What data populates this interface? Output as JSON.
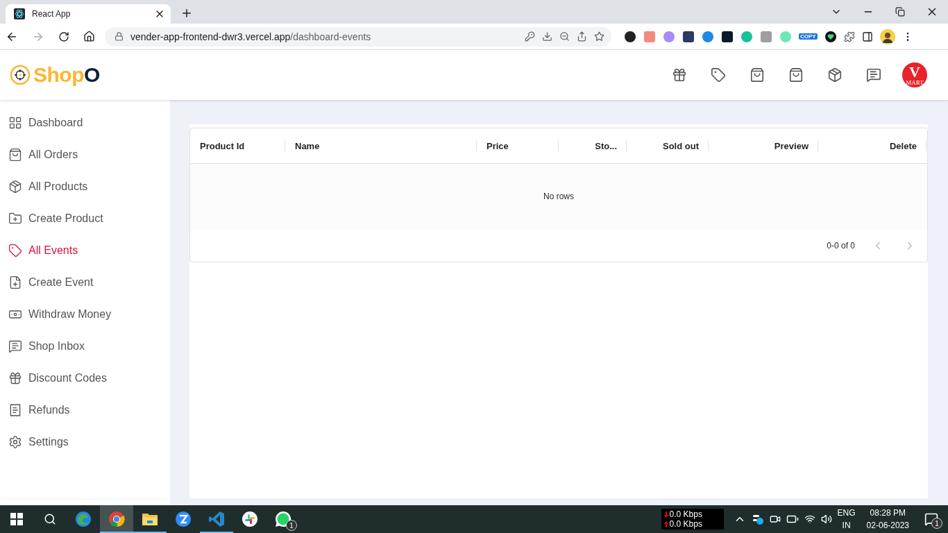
{
  "browser": {
    "tab_title": "React App",
    "url_host": "vender-app-frontend-dwr3.vercel.app",
    "url_path": "/dashboard-events",
    "extension_label": "COPY"
  },
  "header": {
    "logo": {
      "text": "Shop",
      "accent": "O"
    },
    "avatar": {
      "initial": "V",
      "caption": "MART"
    }
  },
  "sidebar": {
    "items": [
      {
        "label": "Dashboard",
        "selected": false
      },
      {
        "label": "All Orders",
        "selected": false
      },
      {
        "label": "All Products",
        "selected": false
      },
      {
        "label": "Create Product",
        "selected": false
      },
      {
        "label": "All Events",
        "selected": true
      },
      {
        "label": "Create Event",
        "selected": false
      },
      {
        "label": "Withdraw Money",
        "selected": false
      },
      {
        "label": "Shop Inbox",
        "selected": false
      },
      {
        "label": "Discount Codes",
        "selected": false
      },
      {
        "label": "Refunds",
        "selected": false
      },
      {
        "label": "Settings",
        "selected": false
      }
    ]
  },
  "table": {
    "columns": [
      {
        "label": "Product Id"
      },
      {
        "label": "Name"
      },
      {
        "label": "Price"
      },
      {
        "label": "Sto..."
      },
      {
        "label": "Sold out"
      },
      {
        "label": "Preview"
      },
      {
        "label": "Delete"
      }
    ],
    "empty_message": "No rows",
    "pagination": {
      "range": "0-0 of 0",
      "previous_disabled": true,
      "next_disabled": true
    }
  },
  "taskbar": {
    "apps": [
      {
        "running": false,
        "selected": false
      },
      {
        "running": true,
        "selected": true
      },
      {
        "running": true,
        "selected": false
      },
      {
        "running": false,
        "selected": false
      },
      {
        "running": true,
        "selected": false
      },
      {
        "running": false,
        "selected": false
      },
      {
        "running": false,
        "selected": false,
        "badge": "1"
      }
    ],
    "net_speeds": [
      "0.0 Kbps",
      "0.0 Kbps"
    ],
    "language": [
      "ENG",
      "IN"
    ],
    "time": "08:28 PM",
    "date": "02-06-2023",
    "notifications": "1"
  }
}
